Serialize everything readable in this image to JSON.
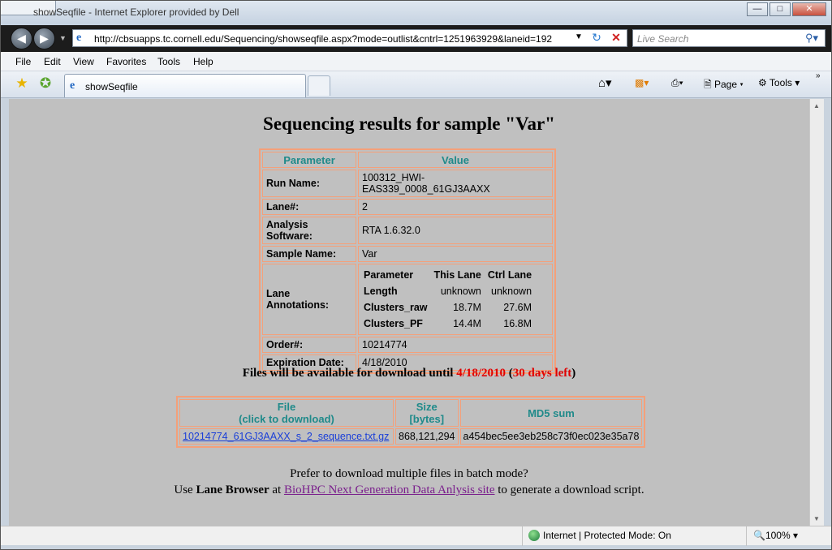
{
  "window": {
    "title": "showSeqfile - Internet Explorer provided by Dell"
  },
  "nav": {
    "url": "http://cbsuapps.tc.cornell.edu/Sequencing/showseqfile.aspx?mode=outlist&cntrl=1251963929&laneid=192",
    "search_placeholder": "Live Search"
  },
  "menu": [
    "File",
    "Edit",
    "View",
    "Favorites",
    "Tools",
    "Help"
  ],
  "tab": {
    "label": "showSeqfile"
  },
  "commands": {
    "page": "Page",
    "tools": "Tools"
  },
  "page": {
    "title": "Sequencing results for sample \"Var\"",
    "info_headers": [
      "Parameter",
      "Value"
    ],
    "info": [
      {
        "k": "Run Name:",
        "v": "100312_HWI-EAS339_0008_61GJ3AAXX"
      },
      {
        "k": "Lane#:",
        "v": "2"
      },
      {
        "k": "Analysis Software:",
        "v": "RTA 1.6.32.0"
      },
      {
        "k": "Sample Name:",
        "v": "Var"
      }
    ],
    "lane_annotations": {
      "label": "Lane Annotations:",
      "headers": [
        "Parameter",
        "This Lane",
        "Ctrl Lane"
      ],
      "rows": [
        [
          "Length",
          "unknown",
          "unknown"
        ],
        [
          "Clusters_raw",
          "18.7M",
          "27.6M"
        ],
        [
          "Clusters_PF",
          "14.4M",
          "16.8M"
        ]
      ]
    },
    "info2": [
      {
        "k": "Order#:",
        "v": "10214774"
      },
      {
        "k": "Expiration Date:",
        "v": "4/18/2010"
      }
    ],
    "availability": {
      "prefix": "Files will be available for download until ",
      "date": "4/18/2010",
      "open": " (",
      "days": "30 days left",
      "close": ")"
    },
    "files": {
      "h_file_1": "File",
      "h_file_2": "(click to download)",
      "h_size_1": "Size",
      "h_size_2": "[bytes]",
      "h_md5": "MD5 sum",
      "rows": [
        {
          "name": "10214774_61GJ3AAXX_s_2_sequence.txt.gz",
          "size": "868,121,294",
          "md5": "a454bec5ee3eb258c73f0ec023e35a78"
        }
      ]
    },
    "batch": {
      "line1": "Prefer to download multiple files in batch mode?",
      "use": "Use ",
      "lane_browser": "Lane Browser",
      "at": " at ",
      "site_link": "BioHPC Next Generation Data Anlysis site",
      "suffix": " to generate a download script."
    }
  },
  "status": {
    "zone": "Internet | Protected Mode: On",
    "zoom": "100%"
  }
}
